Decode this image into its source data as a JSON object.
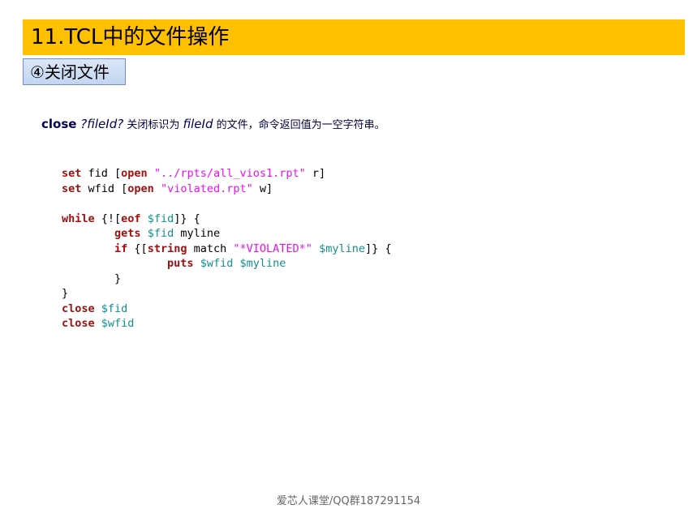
{
  "header": {
    "title": "11.TCL中的文件操作",
    "subtitle": "④关闭文件"
  },
  "description": {
    "command": "close",
    "arg_prefix": " ?",
    "arg": "fileId",
    "arg_suffix": "?",
    "text1": " 关闭标识为 ",
    "arg2": "fileId",
    "text2": " 的文件，命令返回值为一空字符串。"
  },
  "code": {
    "lines": [
      [
        {
          "t": "set",
          "c": "k"
        },
        {
          "t": " fid [",
          "c": ""
        },
        {
          "t": "open",
          "c": "k"
        },
        {
          "t": " ",
          "c": ""
        },
        {
          "t": "\"../rpts/all_vios1.rpt\"",
          "c": "s"
        },
        {
          "t": " r]",
          "c": ""
        }
      ],
      [
        {
          "t": "set",
          "c": "k"
        },
        {
          "t": " wfid [",
          "c": ""
        },
        {
          "t": "open",
          "c": "k"
        },
        {
          "t": " ",
          "c": ""
        },
        {
          "t": "\"violated.rpt\"",
          "c": "s"
        },
        {
          "t": " w]",
          "c": ""
        }
      ],
      [],
      [
        {
          "t": "while",
          "c": "k"
        },
        {
          "t": " {![",
          "c": ""
        },
        {
          "t": "eof",
          "c": "k"
        },
        {
          "t": " ",
          "c": ""
        },
        {
          "t": "$fid",
          "c": "v"
        },
        {
          "t": "]} {",
          "c": ""
        }
      ],
      [
        {
          "t": "        ",
          "c": ""
        },
        {
          "t": "gets",
          "c": "k"
        },
        {
          "t": " ",
          "c": ""
        },
        {
          "t": "$fid",
          "c": "v"
        },
        {
          "t": " myline",
          "c": ""
        }
      ],
      [
        {
          "t": "        ",
          "c": ""
        },
        {
          "t": "if",
          "c": "k"
        },
        {
          "t": " {[",
          "c": ""
        },
        {
          "t": "string",
          "c": "k"
        },
        {
          "t": " match ",
          "c": ""
        },
        {
          "t": "\"*VIOLATED*\"",
          "c": "s"
        },
        {
          "t": " ",
          "c": ""
        },
        {
          "t": "$myline",
          "c": "v"
        },
        {
          "t": "]} {",
          "c": ""
        }
      ],
      [
        {
          "t": "                ",
          "c": ""
        },
        {
          "t": "puts",
          "c": "k"
        },
        {
          "t": " ",
          "c": ""
        },
        {
          "t": "$wfid",
          "c": "v"
        },
        {
          "t": " ",
          "c": ""
        },
        {
          "t": "$myline",
          "c": "v"
        }
      ],
      [
        {
          "t": "        }",
          "c": ""
        }
      ],
      [
        {
          "t": "}",
          "c": ""
        }
      ],
      [
        {
          "t": "close",
          "c": "k"
        },
        {
          "t": " ",
          "c": ""
        },
        {
          "t": "$fid",
          "c": "v"
        }
      ],
      [
        {
          "t": "close",
          "c": "k"
        },
        {
          "t": " ",
          "c": ""
        },
        {
          "t": "$wfid",
          "c": "v"
        }
      ]
    ]
  },
  "footer": {
    "text": "爱芯人课堂/QQ群187291154"
  },
  "colors": {
    "title_bar": "#ffc000",
    "keyword": "#a01010",
    "string": "#ee10ee",
    "variable": "#109090"
  }
}
